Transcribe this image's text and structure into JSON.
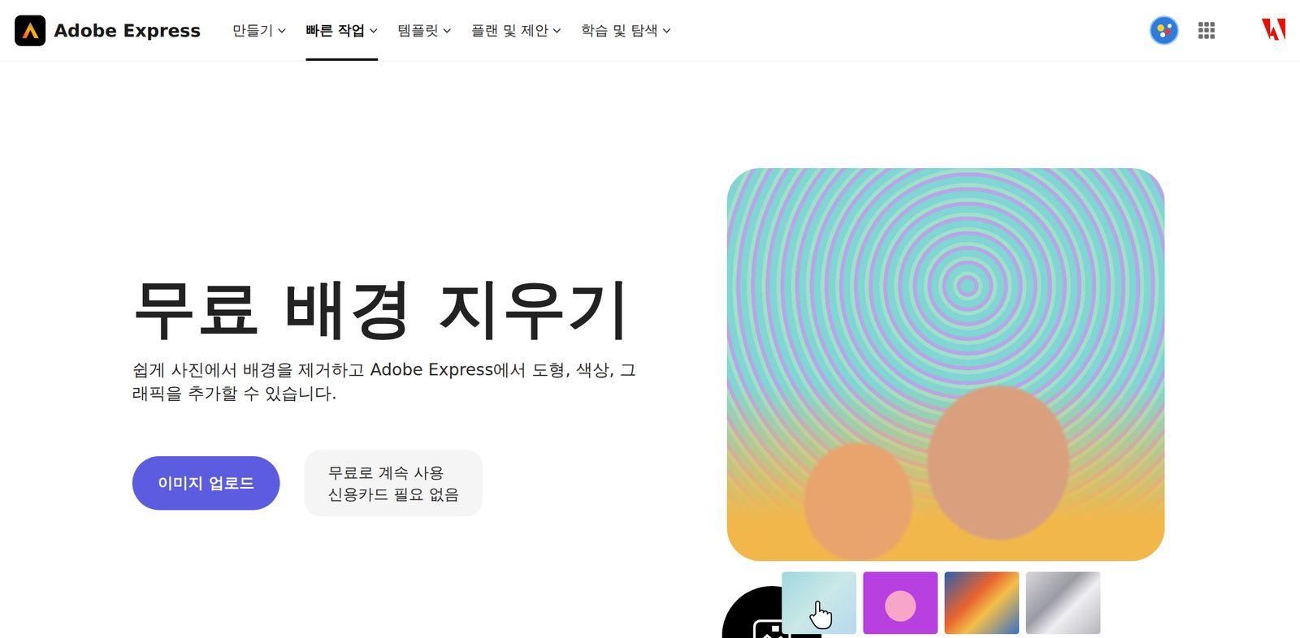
{
  "header": {
    "brand": "Adobe Express",
    "nav": [
      {
        "label": "만들기",
        "selected": false
      },
      {
        "label": "빠른 작업",
        "selected": true
      },
      {
        "label": "템플릿",
        "selected": false
      },
      {
        "label": "플랜 및 제안",
        "selected": false
      },
      {
        "label": "학습 및 탐색",
        "selected": false
      }
    ]
  },
  "hero": {
    "title": "무료 배경 지우기",
    "subtitle": "쉽게 사진에서 배경을 제거하고 Adobe Express에서 도형, 색상, 그래픽을 추가할 수 있습니다.",
    "upload_button": "이미지 업로드",
    "note": [
      "무료로 계속 사용",
      "신용카드 필요 없음"
    ]
  }
}
